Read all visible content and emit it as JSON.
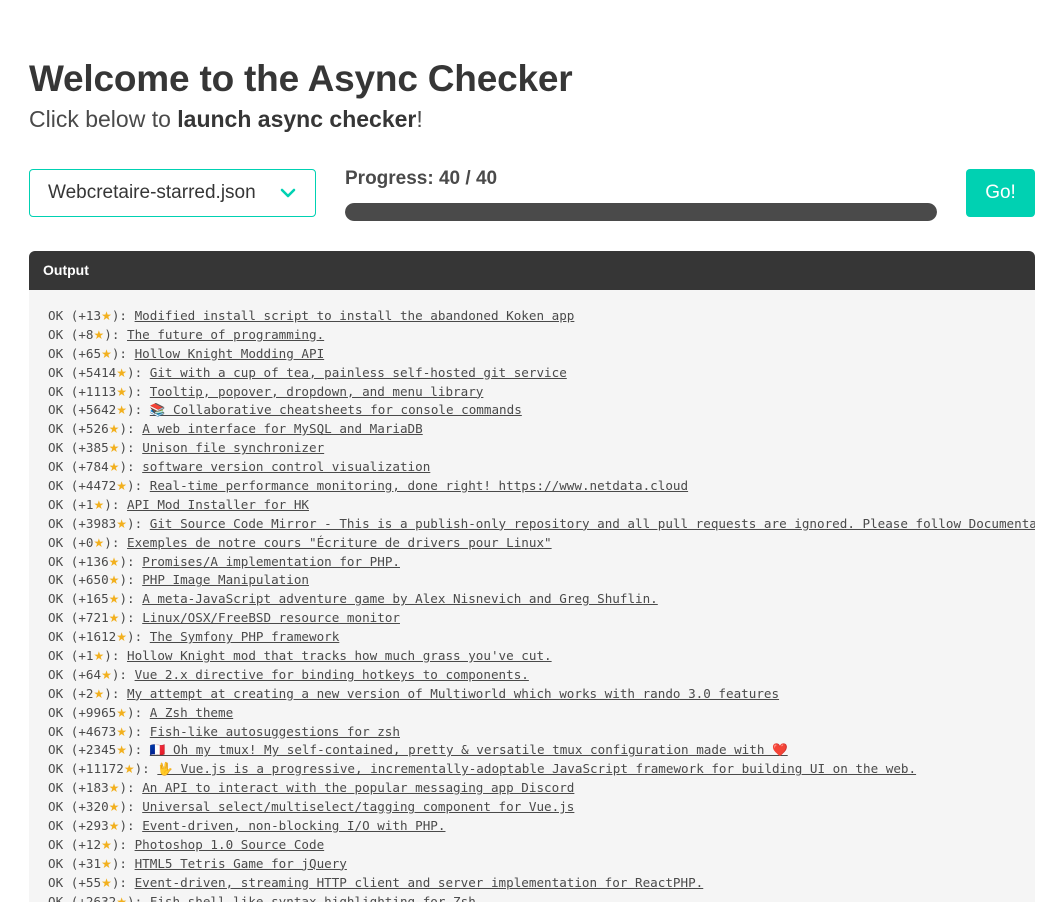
{
  "header": {
    "title": "Welcome to the Async Checker",
    "subtitle_prefix": "Click below to ",
    "subtitle_bold": "launch async checker",
    "subtitle_suffix": "!"
  },
  "controls": {
    "selected_file": "Webcretaire-starred.json",
    "progress_label": "Progress: 40 / 40",
    "progress_fraction": 1.0,
    "go_label": "Go!",
    "accent_color": "#00d1b2"
  },
  "output": {
    "title": "Output",
    "star_glyph": "★",
    "lines": [
      {
        "status": "OK",
        "stars": "+13",
        "text": "Modified install script to install the abandoned Koken app"
      },
      {
        "status": "OK",
        "stars": "+8",
        "text": "The future of programming."
      },
      {
        "status": "OK",
        "stars": "+65",
        "text": "Hollow Knight Modding API"
      },
      {
        "status": "OK",
        "stars": "+5414",
        "text": "Git with a cup of tea, painless self-hosted git service"
      },
      {
        "status": "OK",
        "stars": "+1113",
        "text": "Tooltip, popover, dropdown, and menu library"
      },
      {
        "status": "OK",
        "stars": "+5642",
        "text": "📚 Collaborative cheatsheets for console commands"
      },
      {
        "status": "OK",
        "stars": "+526",
        "text": "A web interface for MySQL and MariaDB"
      },
      {
        "status": "OK",
        "stars": "+385",
        "text": "Unison file synchronizer"
      },
      {
        "status": "OK",
        "stars": "+784",
        "text": "software version control visualization"
      },
      {
        "status": "OK",
        "stars": "+4472",
        "text": "Real-time performance monitoring, done right! https://www.netdata.cloud"
      },
      {
        "status": "OK",
        "stars": "+1",
        "text": "API Mod Installer for HK"
      },
      {
        "status": "OK",
        "stars": "+3983",
        "text": "Git Source Code Mirror - This is a publish-only repository and all pull requests are ignored. Please follow Documentation"
      },
      {
        "status": "OK",
        "stars": "+0",
        "text": "Exemples de notre cours \"Écriture de drivers pour Linux\""
      },
      {
        "status": "OK",
        "stars": "+136",
        "text": "Promises/A implementation for PHP."
      },
      {
        "status": "OK",
        "stars": "+650",
        "text": "PHP Image Manipulation"
      },
      {
        "status": "OK",
        "stars": "+165",
        "text": "A meta-JavaScript adventure game by Alex Nisnevich and Greg Shuflin."
      },
      {
        "status": "OK",
        "stars": "+721",
        "text": "Linux/OSX/FreeBSD resource monitor"
      },
      {
        "status": "OK",
        "stars": "+1612",
        "text": "The Symfony PHP framework"
      },
      {
        "status": "OK",
        "stars": "+1",
        "text": "Hollow Knight mod that tracks how much grass you've cut."
      },
      {
        "status": "OK",
        "stars": "+64",
        "text": "Vue 2.x directive for binding hotkeys to components."
      },
      {
        "status": "OK",
        "stars": "+2",
        "text": "My attempt at creating a new version of Multiworld which works with rando 3.0 features"
      },
      {
        "status": "OK",
        "stars": "+9965",
        "text": "A Zsh theme"
      },
      {
        "status": "OK",
        "stars": "+4673",
        "text": "Fish-like autosuggestions for zsh"
      },
      {
        "status": "OK",
        "stars": "+2345",
        "text": "🇫🇷 Oh my tmux! My self-contained, pretty & versatile tmux configuration made with ❤️"
      },
      {
        "status": "OK",
        "stars": "+11172",
        "text": "🖖 Vue.js is a progressive, incrementally-adoptable JavaScript framework for building UI on the web."
      },
      {
        "status": "OK",
        "stars": "+183",
        "text": "An API to interact with the popular messaging app Discord"
      },
      {
        "status": "OK",
        "stars": "+320",
        "text": "Universal select/multiselect/tagging component for Vue.js"
      },
      {
        "status": "OK",
        "stars": "+293",
        "text": "Event-driven, non-blocking I/O with PHP."
      },
      {
        "status": "OK",
        "stars": "+12",
        "text": "Photoshop 1.0 Source Code"
      },
      {
        "status": "OK",
        "stars": "+31",
        "text": "HTML5 Tetris Game for jQuery"
      },
      {
        "status": "OK",
        "stars": "+55",
        "text": "Event-driven, streaming HTTP client and server implementation for ReactPHP."
      },
      {
        "status": "OK",
        "stars": "+2632",
        "text": "Fish shell like syntax highlighting for Zsh."
      }
    ]
  }
}
